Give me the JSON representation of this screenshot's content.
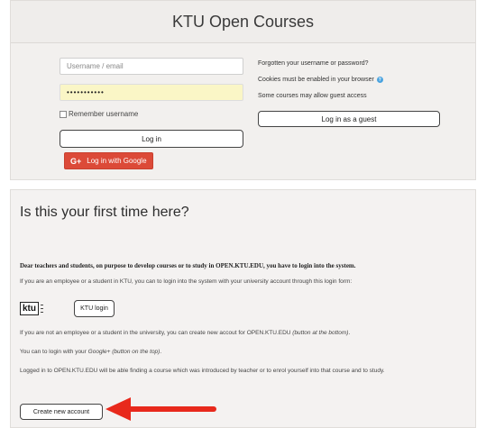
{
  "login": {
    "title": "KTU Open Courses",
    "username_placeholder": "Username / email",
    "password_value": "•••••••••••",
    "remember_label": "Remember username",
    "login_button": "Log in",
    "google_icon": "G+",
    "google_button": "Log in with Google",
    "forgot_link": "Forgotten your username or password?",
    "cookies_text": "Cookies must be enabled in your browser",
    "guest_text": "Some courses may allow guest access",
    "guest_button": "Log in as a guest"
  },
  "info": {
    "title": "Is this your first time here?",
    "bold_text": "Dear teachers and students, on purpose to develop courses or to study in OPEN.KTU.EDU, you have to login into the system.",
    "line1": "If you are an employee or a student in KTU, you can to login into the system with your university account through this login form:",
    "ktu_logo_text": "ktu",
    "ktu_login_button": "KTU login",
    "line2_main": "If you are not an employee or a student in the university, you can create new accout for OPEN.KTU.EDU ",
    "line2_em": "(button at the bottom)",
    "line2_end": ".",
    "line3_main": "You can to login with your ",
    "line3_em": "Google+ (button on the top)",
    "line3_end": ".",
    "line4": "Logged in to OPEN.KTU.EDU will be able finding a course which was introduced by teacher or to enrol yourself into that course and to study.",
    "create_button": "Create new account"
  },
  "icons": {
    "help": "question-icon",
    "arrow": "red-arrow-pointer"
  },
  "colors": {
    "google_red": "#dc4a38",
    "arrow_red": "#e8291c",
    "password_bg": "#faf6c6"
  }
}
